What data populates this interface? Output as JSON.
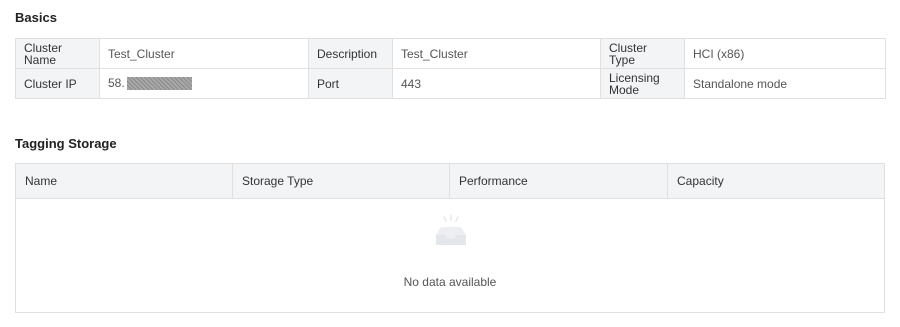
{
  "basics": {
    "title": "Basics",
    "rows": [
      [
        {
          "label": "Cluster Name",
          "value": "Test_Cluster"
        },
        {
          "label": "Description",
          "value": "Test_Cluster"
        },
        {
          "label": "Cluster Type",
          "value": "HCI (x86)"
        }
      ],
      [
        {
          "label": "Cluster IP",
          "value": "58."
        },
        {
          "label": "Port",
          "value": "443"
        },
        {
          "label": "Licensing Mode",
          "value": "Standalone mode"
        }
      ]
    ]
  },
  "tagging_storage": {
    "title": "Tagging Storage",
    "columns": [
      "Name",
      "Storage Type",
      "Performance",
      "Capacity"
    ],
    "empty_text": "No data available",
    "empty_icon": "empty-inbox-icon"
  },
  "colors": {
    "label_bg": "#f3f4f6",
    "border": "#e0e0e0",
    "icon": "#e6e8ec"
  }
}
